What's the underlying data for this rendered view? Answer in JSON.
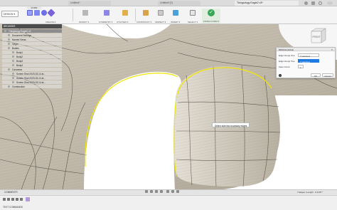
{
  "window": {
    "tabs": [
      {
        "label": "Thingiology Eagle2 v3*",
        "active": true
      },
      {
        "label": "Untitled*",
        "active": false
      },
      {
        "label": "Untitled*(2)",
        "active": false
      }
    ]
  },
  "toolbar": {
    "workspace_label": "DESIGN",
    "active_tab_label": "FORM",
    "groups": [
      {
        "label": "CREATE"
      },
      {
        "label": "MODIFY"
      },
      {
        "label": "SYMMETRY"
      },
      {
        "label": "UTILITIES"
      },
      {
        "label": "CONSTRUCT"
      },
      {
        "label": "INSPECT"
      },
      {
        "label": "INSERT"
      },
      {
        "label": "SELECT"
      },
      {
        "label": "FINISH FORM"
      }
    ]
  },
  "browser": {
    "title": "BROWSER",
    "items": [
      {
        "label": "Thingiology Eagle2 v3",
        "selected": true
      },
      {
        "label": "Document Settings",
        "selected": false
      },
      {
        "label": "Named Views",
        "selected": false
      },
      {
        "label": "Origin",
        "selected": false
      },
      {
        "label": "Bodies",
        "selected": false
      },
      {
        "label": "Body1",
        "selected": false
      },
      {
        "label": "Body2",
        "selected": false
      },
      {
        "label": "Body3",
        "selected": false
      },
      {
        "label": "Body4",
        "selected": false
      },
      {
        "label": "Canvases",
        "selected": false
      },
      {
        "label": "Screen Shot 2023-03-14 at...",
        "selected": false
      },
      {
        "label": "Screen Shot 2023-03-14 at...",
        "selected": false
      },
      {
        "label": "Screen Shot 2023-03-14 at...",
        "selected": false
      },
      {
        "label": "Construction",
        "selected": false
      }
    ]
  },
  "dialog": {
    "title": "BRIDGE EDGE",
    "rows": [
      {
        "label": "Edge Group One",
        "value": "7 selected",
        "highlight": false
      },
      {
        "label": "Edge Group Two",
        "value": "7 selected",
        "highlight": true
      },
      {
        "label": "Face Count",
        "value": "1",
        "highlight": false
      }
    ],
    "ok_label": "OK",
    "cancel_label": "Cancel"
  },
  "tooltip": "Select side two boundary edges",
  "viewcube": {
    "face_label": "FRONT"
  },
  "bottom": {
    "comments_label": "COMMENTS",
    "status_text": "7 Edges | Length : 0.1178 *",
    "text_commands_label": "TEXT COMMANDS"
  },
  "colors": {
    "surface": "#c9c1b3",
    "surface_dark": "#9e9789",
    "selection": "#f2e600",
    "accent": "#1f7ae0",
    "finish": "#3aa657"
  }
}
